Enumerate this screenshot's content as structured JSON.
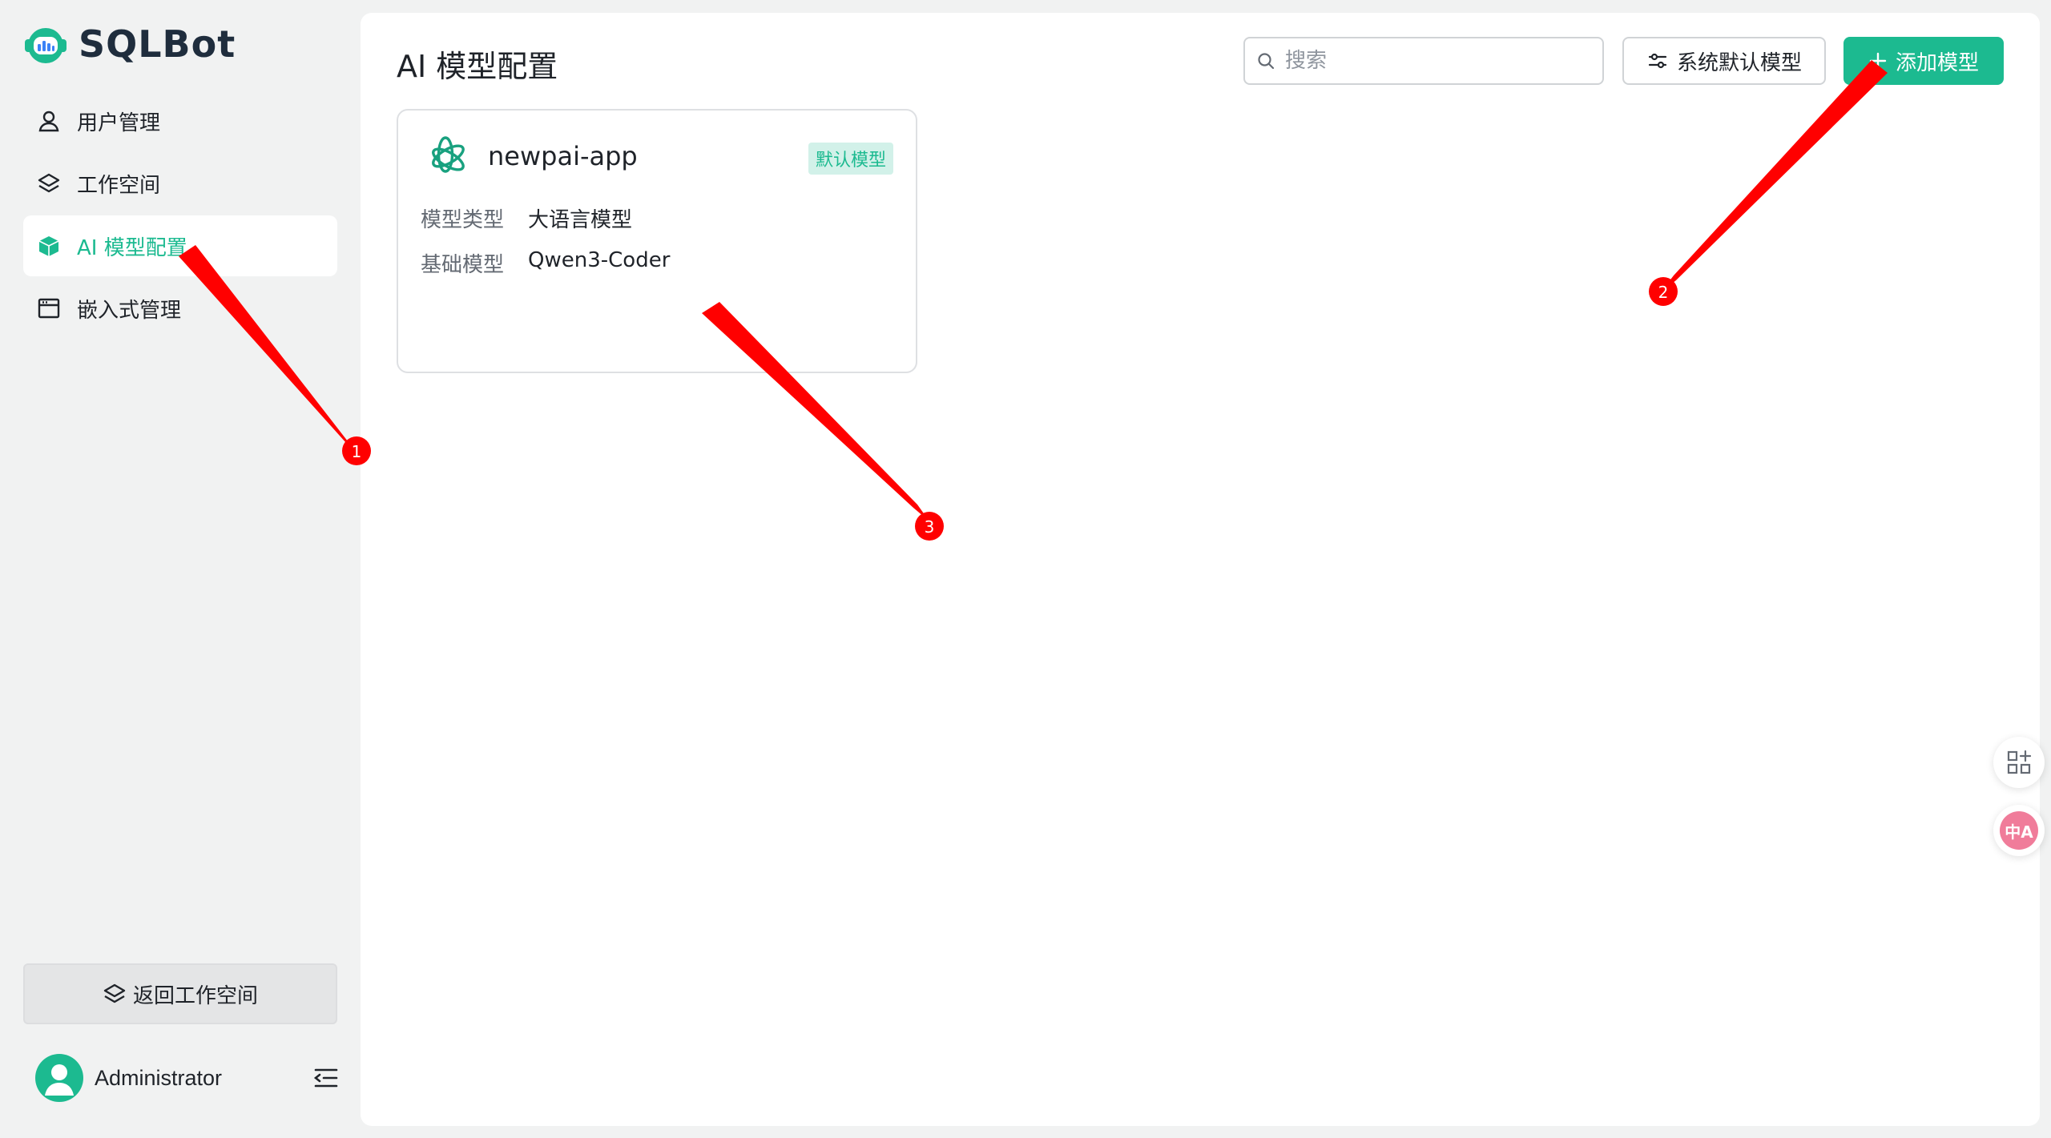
{
  "app": {
    "name": "SQLBot"
  },
  "sidebar": {
    "items": [
      {
        "label": "用户管理",
        "icon": "user-icon",
        "active": false
      },
      {
        "label": "工作空间",
        "icon": "layers-icon",
        "active": false
      },
      {
        "label": "AI 模型配置",
        "icon": "cube-icon",
        "active": true
      },
      {
        "label": "嵌入式管理",
        "icon": "window-icon",
        "active": false
      }
    ],
    "back_button": "返回工作空间",
    "user_name": "Administrator"
  },
  "main": {
    "title": "AI 模型配置",
    "search_placeholder": "搜索",
    "system_default_button": "系统默认模型",
    "add_button": "添加模型"
  },
  "model_card": {
    "name": "newpai-app",
    "badge": "默认模型",
    "type_label": "模型类型",
    "type_value": "大语言模型",
    "base_label": "基础模型",
    "base_value": "Qwen3-Coder"
  },
  "floating": {
    "translate_glyph": "中A"
  },
  "annotations": {
    "labels": [
      "1",
      "2",
      "3"
    ]
  },
  "colors": {
    "accent": "#1cba90",
    "annotation": "#ff0000",
    "background": "#f1f2f2"
  }
}
